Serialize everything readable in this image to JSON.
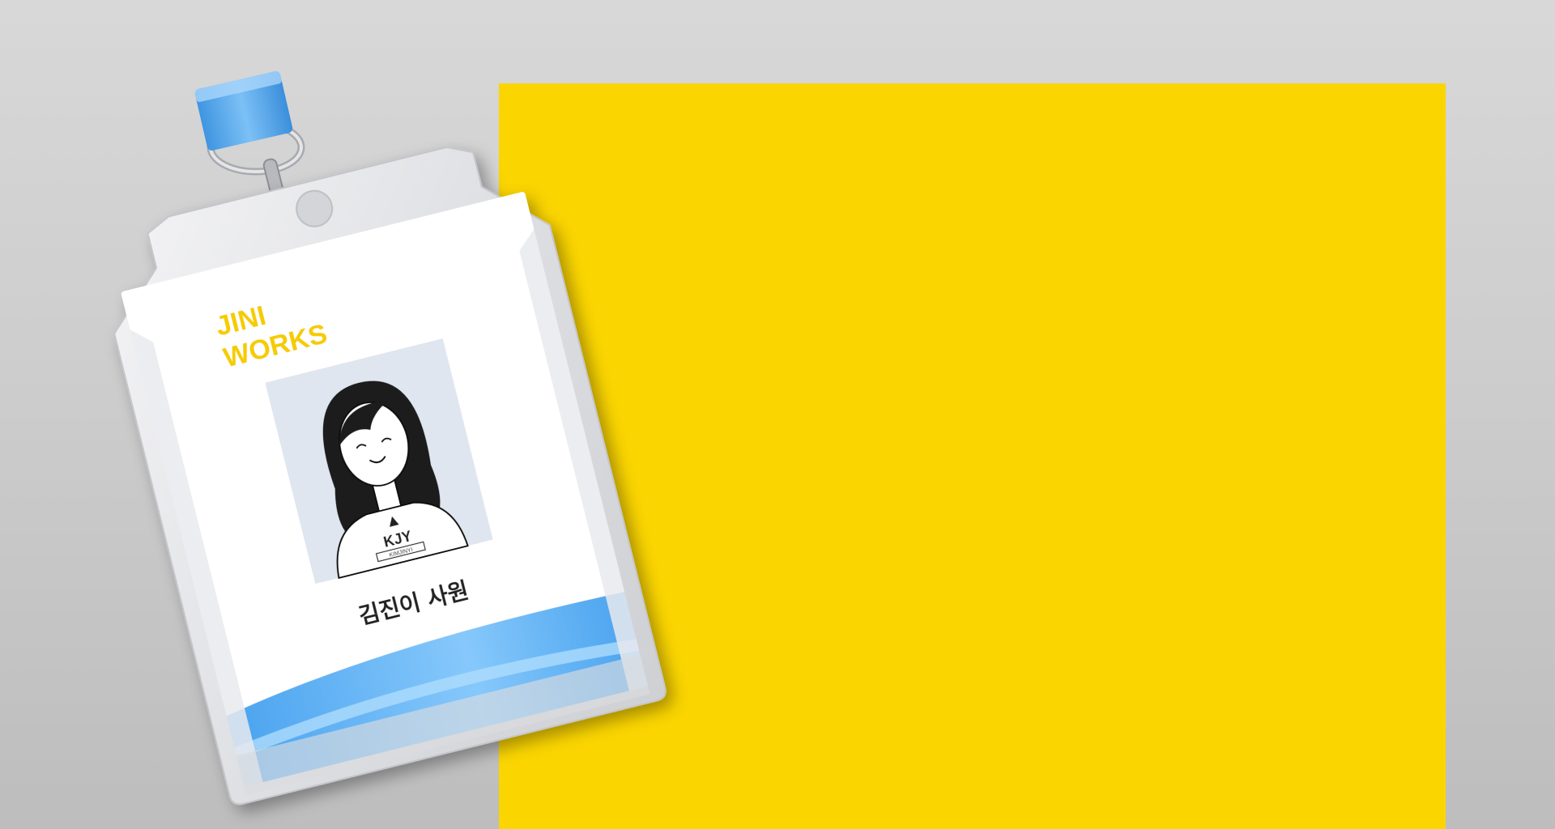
{
  "card": {
    "company_line1": "JINI",
    "company_line2": "WORKS",
    "name": "김진이 사원",
    "shirt_logo": "KJY",
    "shirt_sub": "KIMJINYI"
  },
  "colors": {
    "panel": "#fbd500",
    "brand": "#f5cc00",
    "clip": "#4ea6ee",
    "stripe": "#57adf4"
  }
}
